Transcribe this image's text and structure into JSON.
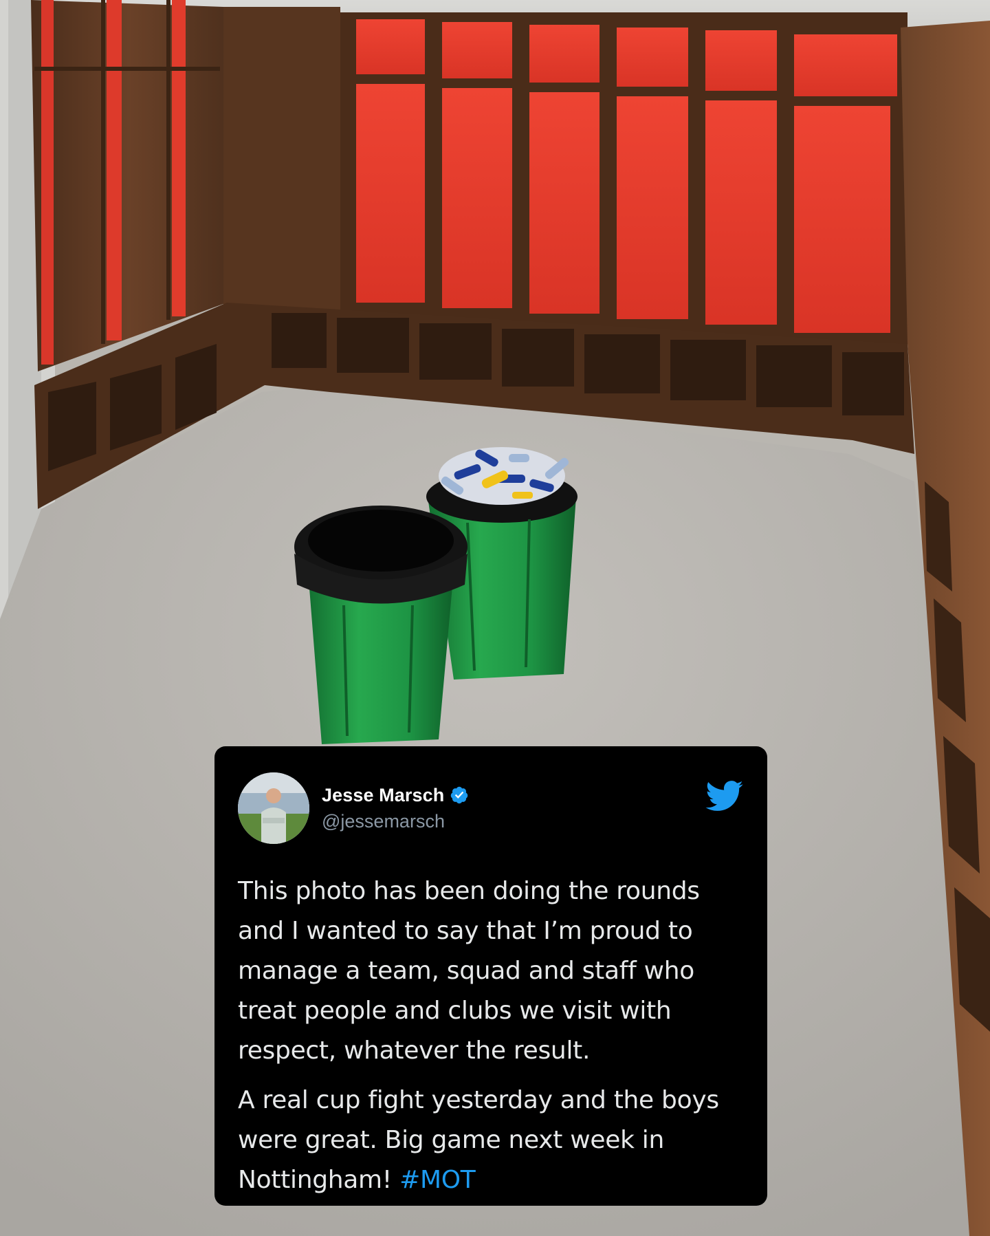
{
  "tweet": {
    "display_name": "Jesse Marsch",
    "handle": "@jessemarsch",
    "paragraph_1": "This photo has been doing the rounds and I wanted to say that I’m proud to manage a team, squad and staff who treat people and clubs we visit with respect, whatever the result.",
    "paragraph_2_text": "A real cup fight yesterday and the boys were great. Big game next week in Nottingham! ",
    "hashtag": "#MOT"
  },
  "icons": {
    "verified": "verified-badge-icon",
    "brand": "twitter-bird-icon"
  },
  "colors": {
    "card_background": "#000000",
    "text": "#e7e9ea",
    "handle": "#8b98a5",
    "hashtag": "#1d9bf0",
    "verified": "#1d9bf0",
    "locker_red": "#e53a2c",
    "wood": "#5b3a24",
    "bin_green": "#1f9a46"
  }
}
